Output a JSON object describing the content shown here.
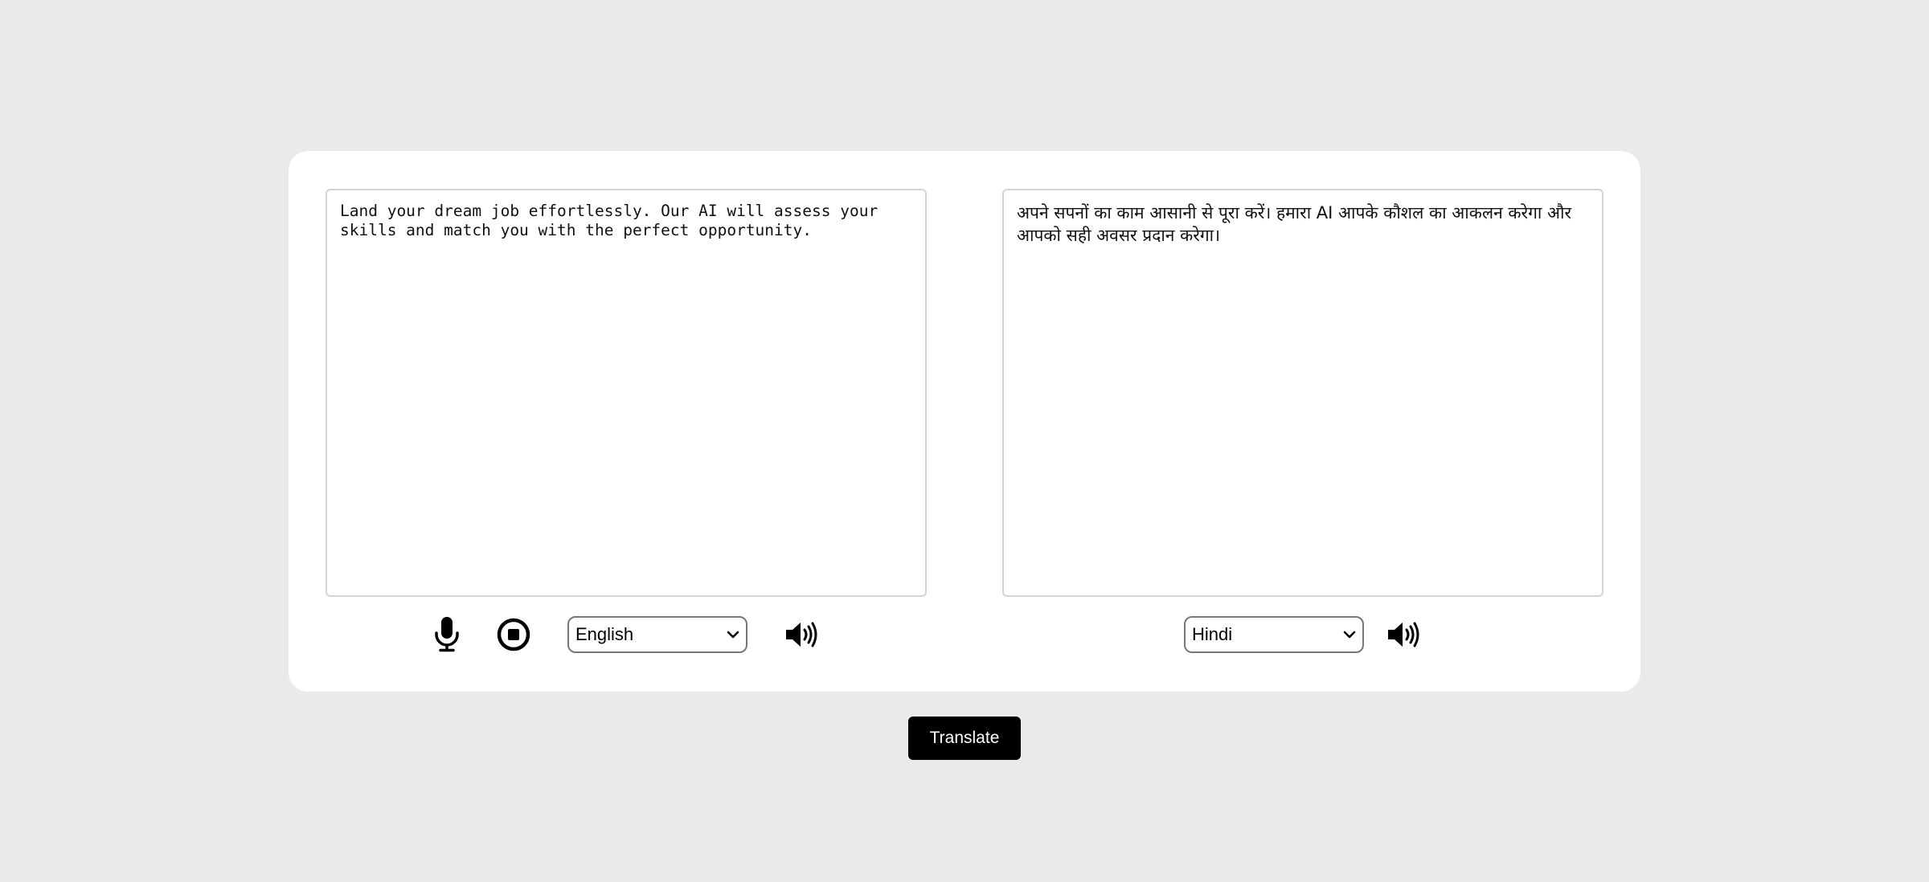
{
  "source_panel": {
    "text": "Land your dream job effortlessly. Our AI will assess your skills and match you with the perfect opportunity.",
    "language": "English",
    "icons": {
      "mic": "microphone-icon",
      "stop": "stop-circle-icon",
      "speak": "speaker-icon"
    }
  },
  "target_panel": {
    "text": "अपने सपनों का काम आसानी से पूरा करें। हमारा AI आपके कौशल का आकलन करेगा और आपको सही अवसर प्रदान करेगा।",
    "language": "Hindi",
    "icons": {
      "speak": "speaker-icon"
    }
  },
  "translate_button": {
    "label": "Translate"
  },
  "colors": {
    "background": "#eaeaea",
    "card": "#ffffff",
    "button": "#000000",
    "button_text": "#ffffff"
  }
}
